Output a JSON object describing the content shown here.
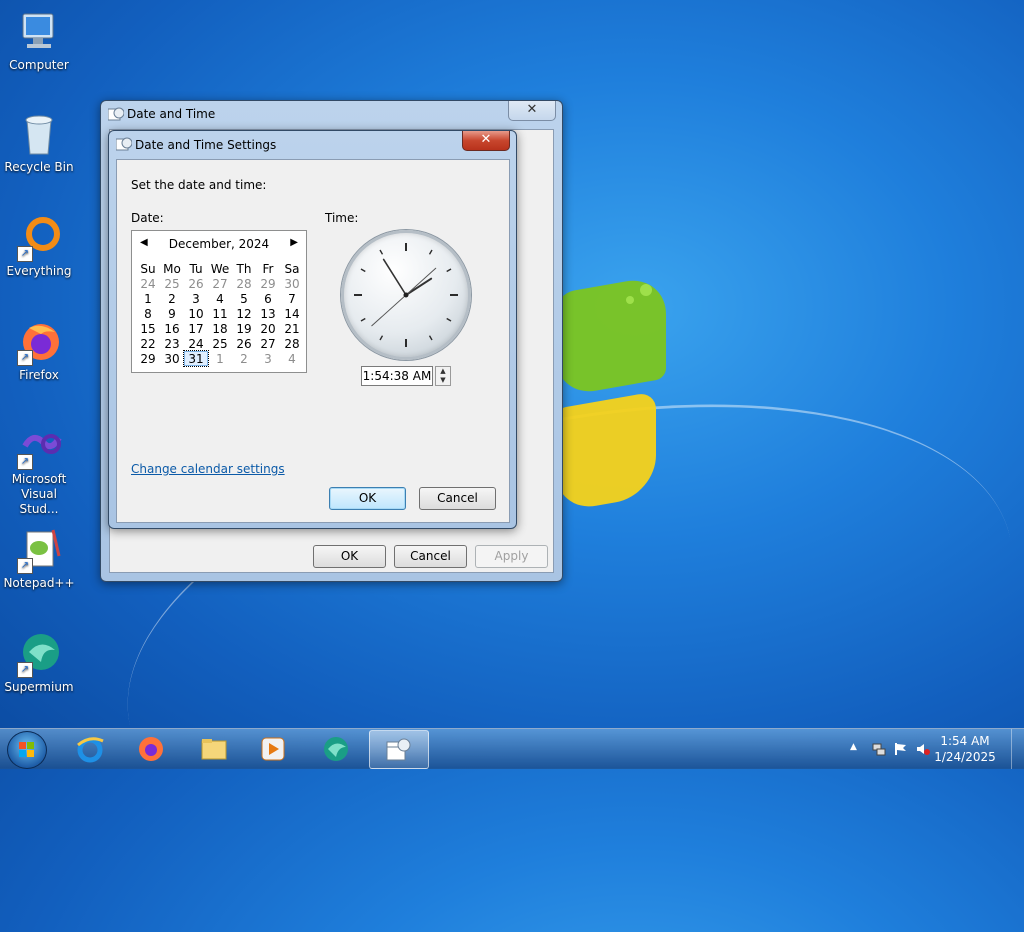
{
  "desktop": {
    "icons": [
      {
        "label": "Computer"
      },
      {
        "label": "Recycle Bin"
      },
      {
        "label": "Everything"
      },
      {
        "label": "Firefox"
      },
      {
        "label": "Microsoft Visual Stud..."
      },
      {
        "label": "Notepad++"
      },
      {
        "label": "Supermium"
      }
    ]
  },
  "outer_window": {
    "title": "Date and Time",
    "close": "✕",
    "buttons": {
      "ok": "OK",
      "cancel": "Cancel",
      "apply": "Apply"
    }
  },
  "dialog": {
    "title": "Date and Time Settings",
    "close": "✕",
    "instruction": "Set the date and time:",
    "date_label": "Date:",
    "time_label": "Time:",
    "calendar": {
      "month": "December, 2024",
      "prev": "◀",
      "next": "▶",
      "weekdays": [
        "Su",
        "Mo",
        "Tu",
        "We",
        "Th",
        "Fr",
        "Sa"
      ],
      "weeks": [
        [
          "24",
          "25",
          "26",
          "27",
          "28",
          "29",
          "30"
        ],
        [
          "1",
          "2",
          "3",
          "4",
          "5",
          "6",
          "7"
        ],
        [
          "8",
          "9",
          "10",
          "11",
          "12",
          "13",
          "14"
        ],
        [
          "15",
          "16",
          "17",
          "18",
          "19",
          "20",
          "21"
        ],
        [
          "22",
          "23",
          "24",
          "25",
          "26",
          "27",
          "28"
        ],
        [
          "29",
          "30",
          "31",
          "1",
          "2",
          "3",
          "4"
        ]
      ],
      "selected": "31"
    },
    "time_value": "1:54:38 AM",
    "clock": {
      "hours": 1,
      "minutes": 54,
      "seconds": 38
    },
    "calendar_link": "Change calendar settings",
    "ok": "OK",
    "cancel": "Cancel"
  },
  "taskbar": {
    "apps": [
      "internet-explorer",
      "firefox",
      "file-explorer",
      "media-player",
      "supermium",
      "date-time-settings"
    ],
    "clock_time": "1:54 AM",
    "clock_date": "1/24/2025",
    "tray_arrow": "▲"
  }
}
